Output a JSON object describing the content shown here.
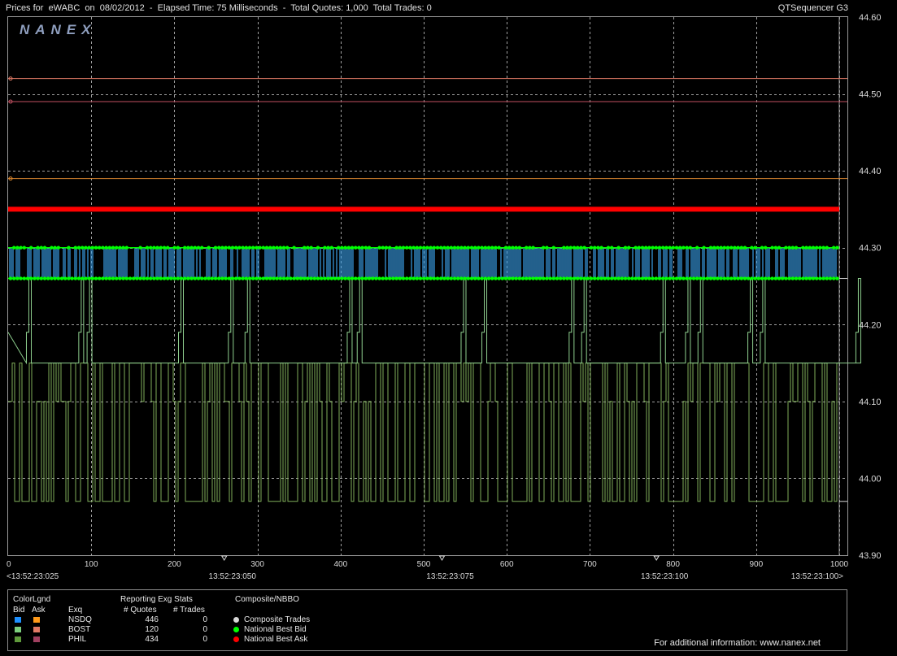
{
  "header": {
    "title": "Prices for  eWABC  on  08/02/2012  -  Elapsed Time: 75 Milliseconds  -  Total Quotes: 1,000  Total Trades: 0",
    "app": "QTSequencer G3"
  },
  "brand": {
    "watermark": "NANEX"
  },
  "chart_data": {
    "type": "line",
    "title": "",
    "xlabel": "",
    "ylabel": "",
    "xlim": [
      0,
      1000
    ],
    "ylim": [
      43.9,
      44.6
    ],
    "y_ticks": [
      44.6,
      44.5,
      44.4,
      44.3,
      44.2,
      44.1,
      44.0,
      43.9
    ],
    "y_tick_labels": [
      "44.60",
      "44.50",
      "44.40",
      "44.30",
      "44.20",
      "44.10",
      "44.00",
      "43.90"
    ],
    "x_ticks": [
      0,
      100,
      200,
      300,
      400,
      500,
      600,
      700,
      800,
      900,
      1000
    ],
    "time_labels": [
      {
        "x": 0,
        "label": "<13:52:23:025"
      },
      {
        "x": 260,
        "label": "13:52:23:050"
      },
      {
        "x": 522,
        "label": "13:52:23:075"
      },
      {
        "x": 780,
        "label": "13:52:23:100"
      },
      {
        "x": 1000,
        "label": "13:52:23:100>"
      }
    ],
    "grid": true,
    "series": [
      {
        "name": "NSDQ Bid",
        "color": "#3aa0e8",
        "low": 44.26,
        "high": 44.3
      },
      {
        "name": "BOST Bid",
        "color": "#8fd08f",
        "low": 44.26,
        "high": 44.3
      },
      {
        "name": "PHIL Bid",
        "color": "#7fae5a",
        "low": 43.97,
        "high": 44.15
      },
      {
        "name": "National Best Bid",
        "color": "#00ff00",
        "values": [
          44.3,
          44.26
        ]
      },
      {
        "name": "National Best Ask",
        "color": "#ff0000",
        "values": [
          44.35
        ]
      },
      {
        "name": "BOST Ask",
        "color": "#e07a66",
        "values": [
          44.52
        ]
      },
      {
        "name": "PHIL Ask",
        "color": "#c05060",
        "values": [
          44.49
        ]
      },
      {
        "name": "NSDQ Ask",
        "color": "#e08a30",
        "values": [
          44.39
        ]
      }
    ]
  },
  "legend": {
    "color_legend_title": "ColorLgnd",
    "bid_label": "Bid",
    "ask_label": "Ask",
    "exchange_header": "Exq",
    "stats_title": "Reporting Exg Stats",
    "quotes_header": "# Quotes",
    "trades_header": "# Trades",
    "exchanges": [
      {
        "name": "NSDQ",
        "quotes": "446",
        "trades": "0",
        "bid_color": "#1e90ff",
        "ask_color": "#ff9a1a"
      },
      {
        "name": "BOST",
        "quotes": "120",
        "trades": "0",
        "bid_color": "#7ccf7c",
        "ask_color": "#e07a66"
      },
      {
        "name": "PHIL",
        "quotes": "434",
        "trades": "0",
        "bid_color": "#5f9a3c",
        "ask_color": "#a04060"
      }
    ],
    "composite_title": "Composite/NBBO",
    "composite_items": [
      {
        "label": "Composite Trades",
        "color": "#d8d8d8"
      },
      {
        "label": "National Best Bid",
        "color": "#00ff00"
      },
      {
        "label": "National Best Ask",
        "color": "#ff0000"
      }
    ],
    "info": "For additional information: www.nanex.net"
  }
}
